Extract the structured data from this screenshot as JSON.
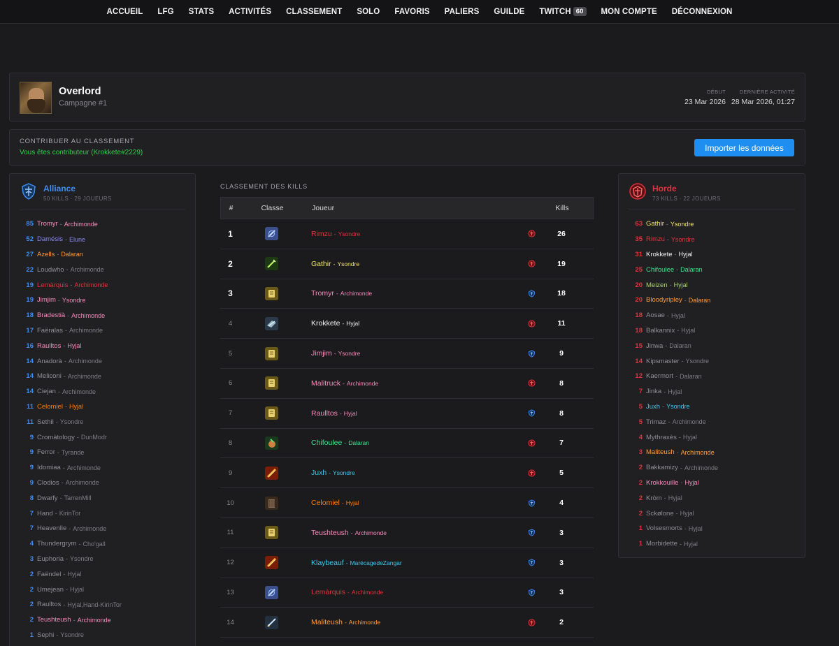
{
  "nav": [
    {
      "label": "ACCUEIL"
    },
    {
      "label": "LFG"
    },
    {
      "label": "STATS"
    },
    {
      "label": "ACTIVITÉS"
    },
    {
      "label": "CLASSEMENT"
    },
    {
      "label": "SOLO"
    },
    {
      "label": "FAVORIS"
    },
    {
      "label": "PALIERS"
    },
    {
      "label": "GUILDE"
    },
    {
      "label": "TWITCH",
      "badge": "60"
    },
    {
      "label": "MON COMPTE"
    },
    {
      "label": "DÉCONNEXION"
    }
  ],
  "profile": {
    "name": "Overlord",
    "subtitle": "Campagne #1",
    "start_label": "DÉBUT",
    "start_value": "23 Mar 2026",
    "last_label": "DERNIÈRE ACTIVITÉ",
    "last_value": "28 Mar 2026, 01:27"
  },
  "contrib": {
    "title": "CONTRIBUER AU CLASSEMENT",
    "status": "Vous êtes contributeur (Krokkete#2229)",
    "button": "Importer les données"
  },
  "alliance": {
    "name": "Alliance",
    "stats": "50 KILLS · 29 JOUEURS",
    "color": "#3f8cf0",
    "players": [
      {
        "kills": "85",
        "name": "Tromyr",
        "realm": "Archimonde",
        "color": "#f48cba"
      },
      {
        "kills": "52",
        "name": "Damésis",
        "realm": "Elune",
        "color": "#8788ee"
      },
      {
        "kills": "27",
        "name": "Azells",
        "realm": "Dalaran",
        "color": "#ff9c3a"
      },
      {
        "kills": "22",
        "name": "Loudwho",
        "realm": "Archimonde",
        "color": "#8f8f94"
      },
      {
        "kills": "19",
        "name": "Lemàrquis",
        "realm": "Archimonde",
        "color": "#e0333d"
      },
      {
        "kills": "19",
        "name": "Jimjim",
        "realm": "Ysondre",
        "color": "#f48cba"
      },
      {
        "kills": "18",
        "name": "Bradestià",
        "realm": "Archimonde",
        "color": "#f48cba"
      },
      {
        "kills": "17",
        "name": "Faëralas",
        "realm": "Archimonde",
        "color": "#8f8f94"
      },
      {
        "kills": "16",
        "name": "Raulltos",
        "realm": "Hyjal",
        "color": "#f48cba"
      },
      {
        "kills": "14",
        "name": "Anadorà",
        "realm": "Archimonde",
        "color": "#8f8f94"
      },
      {
        "kills": "14",
        "name": "Meliconi",
        "realm": "Archimonde",
        "color": "#8f8f94"
      },
      {
        "kills": "14",
        "name": "Ciejan",
        "realm": "Archimonde",
        "color": "#8f8f94"
      },
      {
        "kills": "11",
        "name": "Celomiel",
        "realm": "Hyjal",
        "color": "#ff7d0a"
      },
      {
        "kills": "11",
        "name": "Sethil",
        "realm": "Ysondre",
        "color": "#8f8f94"
      },
      {
        "kills": "9",
        "name": "Cromàtology",
        "realm": "DunModr",
        "color": "#8f8f94"
      },
      {
        "kills": "9",
        "name": "Ferror",
        "realm": "Tyrande",
        "color": "#8f8f94"
      },
      {
        "kills": "9",
        "name": "Idomiaa",
        "realm": "Archimonde",
        "color": "#8f8f94"
      },
      {
        "kills": "9",
        "name": "Clodios",
        "realm": "Archimonde",
        "color": "#8f8f94"
      },
      {
        "kills": "8",
        "name": "Dwarfy",
        "realm": "TarrenMill",
        "color": "#8f8f94"
      },
      {
        "kills": "7",
        "name": "Hand",
        "realm": "KirinTor",
        "color": "#8f8f94"
      },
      {
        "kills": "7",
        "name": "Heavenlie",
        "realm": "Archimonde",
        "color": "#8f8f94"
      },
      {
        "kills": "4",
        "name": "Thundergrym",
        "realm": "Cho'gall",
        "color": "#8f8f94"
      },
      {
        "kills": "3",
        "name": "Euphoria",
        "realm": "Ysondre",
        "color": "#8f8f94"
      },
      {
        "kills": "2",
        "name": "Faëndel",
        "realm": "Hyjal",
        "color": "#8f8f94"
      },
      {
        "kills": "2",
        "name": "Umejean",
        "realm": "Hyjal",
        "color": "#8f8f94"
      },
      {
        "kills": "2",
        "name": "Raulltos",
        "realm": "Hyjal,Hand-KirinTor",
        "color": "#8f8f94"
      },
      {
        "kills": "2",
        "name": "Teushteush",
        "realm": "Archimonde",
        "color": "#f48cba"
      },
      {
        "kills": "1",
        "name": "Sephi",
        "realm": "Ysondre",
        "color": "#8f8f94"
      }
    ]
  },
  "horde": {
    "name": "Horde",
    "stats": "73 KILLS · 22 JOUEURS",
    "color": "#e0333d",
    "players": [
      {
        "kills": "63",
        "name": "Gathir",
        "realm": "Ysondre",
        "color": "#f0e46a"
      },
      {
        "kills": "35",
        "name": "Rimzu",
        "realm": "Ysondre",
        "color": "#e0333d"
      },
      {
        "kills": "31",
        "name": "Krokkete",
        "realm": "Hyjal",
        "color": "#f2f2f2"
      },
      {
        "kills": "25",
        "name": "Chifoulee",
        "realm": "Dalaran",
        "color": "#3fe08f"
      },
      {
        "kills": "20",
        "name": "Meizen",
        "realm": "Hyjal",
        "color": "#aad372"
      },
      {
        "kills": "20",
        "name": "Bloodyripley",
        "realm": "Dalaran",
        "color": "#ff9c3a"
      },
      {
        "kills": "18",
        "name": "Aosae",
        "realm": "Hyjal",
        "color": "#8f8f94"
      },
      {
        "kills": "18",
        "name": "Balkannix",
        "realm": "Hyjal",
        "color": "#8f8f94"
      },
      {
        "kills": "15",
        "name": "Jinwa",
        "realm": "Dalaran",
        "color": "#8f8f94"
      },
      {
        "kills": "14",
        "name": "Kipsmaster",
        "realm": "Ysondre",
        "color": "#8f8f94"
      },
      {
        "kills": "12",
        "name": "Kaermort",
        "realm": "Dalaran",
        "color": "#8f8f94"
      },
      {
        "kills": "7",
        "name": "Jinka",
        "realm": "Hyjal",
        "color": "#8f8f94"
      },
      {
        "kills": "5",
        "name": "Juxh",
        "realm": "Ysondre",
        "color": "#3fc7eb"
      },
      {
        "kills": "5",
        "name": "Trimaz",
        "realm": "Archimonde",
        "color": "#8f8f94"
      },
      {
        "kills": "4",
        "name": "Mythraxès",
        "realm": "Hyjal",
        "color": "#8f8f94"
      },
      {
        "kills": "3",
        "name": "Maliteush",
        "realm": "Archimonde",
        "color": "#ff9c3a"
      },
      {
        "kills": "2",
        "name": "Bakkamizy",
        "realm": "Archimonde",
        "color": "#8f8f94"
      },
      {
        "kills": "2",
        "name": "Krokkouille",
        "realm": "Hyjal",
        "color": "#f48cba"
      },
      {
        "kills": "2",
        "name": "Kròm",
        "realm": "Hyjal",
        "color": "#8f8f94"
      },
      {
        "kills": "2",
        "name": "Sckølone",
        "realm": "Hyjal",
        "color": "#8f8f94"
      },
      {
        "kills": "1",
        "name": "Volsesmorts",
        "realm": "Hyjal",
        "color": "#8f8f94"
      },
      {
        "kills": "1",
        "name": "Morbidette",
        "realm": "Hyjal",
        "color": "#8f8f94"
      }
    ]
  },
  "kills_table": {
    "title": "CLASSEMENT DES KILLS",
    "headers": {
      "rank": "#",
      "class": "Classe",
      "player": "Joueur",
      "kills": "Kills"
    },
    "rows": [
      {
        "rank": "1",
        "name": "Rimzu",
        "realm": "Ysondre",
        "color": "#e0333d",
        "faction": "horde",
        "kills": "26",
        "icon": "mage-icon"
      },
      {
        "rank": "2",
        "name": "Gathir",
        "realm": "Ysondre",
        "color": "#f0e46a",
        "faction": "horde",
        "kills": "19",
        "icon": "rogue-icon"
      },
      {
        "rank": "3",
        "name": "Tromyr",
        "realm": "Archimonde",
        "color": "#f48cba",
        "faction": "alliance",
        "kills": "18",
        "icon": "paladin-icon"
      },
      {
        "rank": "4",
        "name": "Krokkete",
        "realm": "Hyjal",
        "color": "#f2f2f2",
        "faction": "horde",
        "kills": "11",
        "icon": "priest-icon"
      },
      {
        "rank": "5",
        "name": "Jimjim",
        "realm": "Ysondre",
        "color": "#f48cba",
        "faction": "alliance",
        "kills": "9",
        "icon": "paladin-icon"
      },
      {
        "rank": "6",
        "name": "Malitruck",
        "realm": "Archimonde",
        "color": "#f48cba",
        "faction": "horde",
        "kills": "8",
        "icon": "paladin-icon"
      },
      {
        "rank": "7",
        "name": "Raulltos",
        "realm": "Hyjal",
        "color": "#f48cba",
        "faction": "alliance",
        "kills": "8",
        "icon": "paladin-icon"
      },
      {
        "rank": "8",
        "name": "Chifoulee",
        "realm": "Dalaran",
        "color": "#3fe08f",
        "faction": "horde",
        "kills": "7",
        "icon": "monk-icon"
      },
      {
        "rank": "9",
        "name": "Juxh",
        "realm": "Ysondre",
        "color": "#3fc7eb",
        "faction": "horde",
        "kills": "5",
        "icon": "fire-mage-icon"
      },
      {
        "rank": "10",
        "name": "Celomiel",
        "realm": "Hyjal",
        "color": "#ff7d0a",
        "faction": "alliance",
        "kills": "4",
        "icon": "druid-icon"
      },
      {
        "rank": "11",
        "name": "Teushteush",
        "realm": "Archimonde",
        "color": "#f48cba",
        "faction": "alliance",
        "kills": "3",
        "icon": "paladin-icon"
      },
      {
        "rank": "12",
        "name": "Klaybeauf",
        "realm": "MarécagedeZangar",
        "color": "#3fc7eb",
        "faction": "alliance",
        "kills": "3",
        "icon": "fire-mage-icon"
      },
      {
        "rank": "13",
        "name": "Lemàrquis",
        "realm": "Archimonde",
        "color": "#e0333d",
        "faction": "alliance",
        "kills": "3",
        "icon": "mage-icon"
      },
      {
        "rank": "14",
        "name": "Maliteush",
        "realm": "Archimonde",
        "color": "#ff9c3a",
        "faction": "horde",
        "kills": "2",
        "icon": "warrior-icon"
      }
    ]
  }
}
